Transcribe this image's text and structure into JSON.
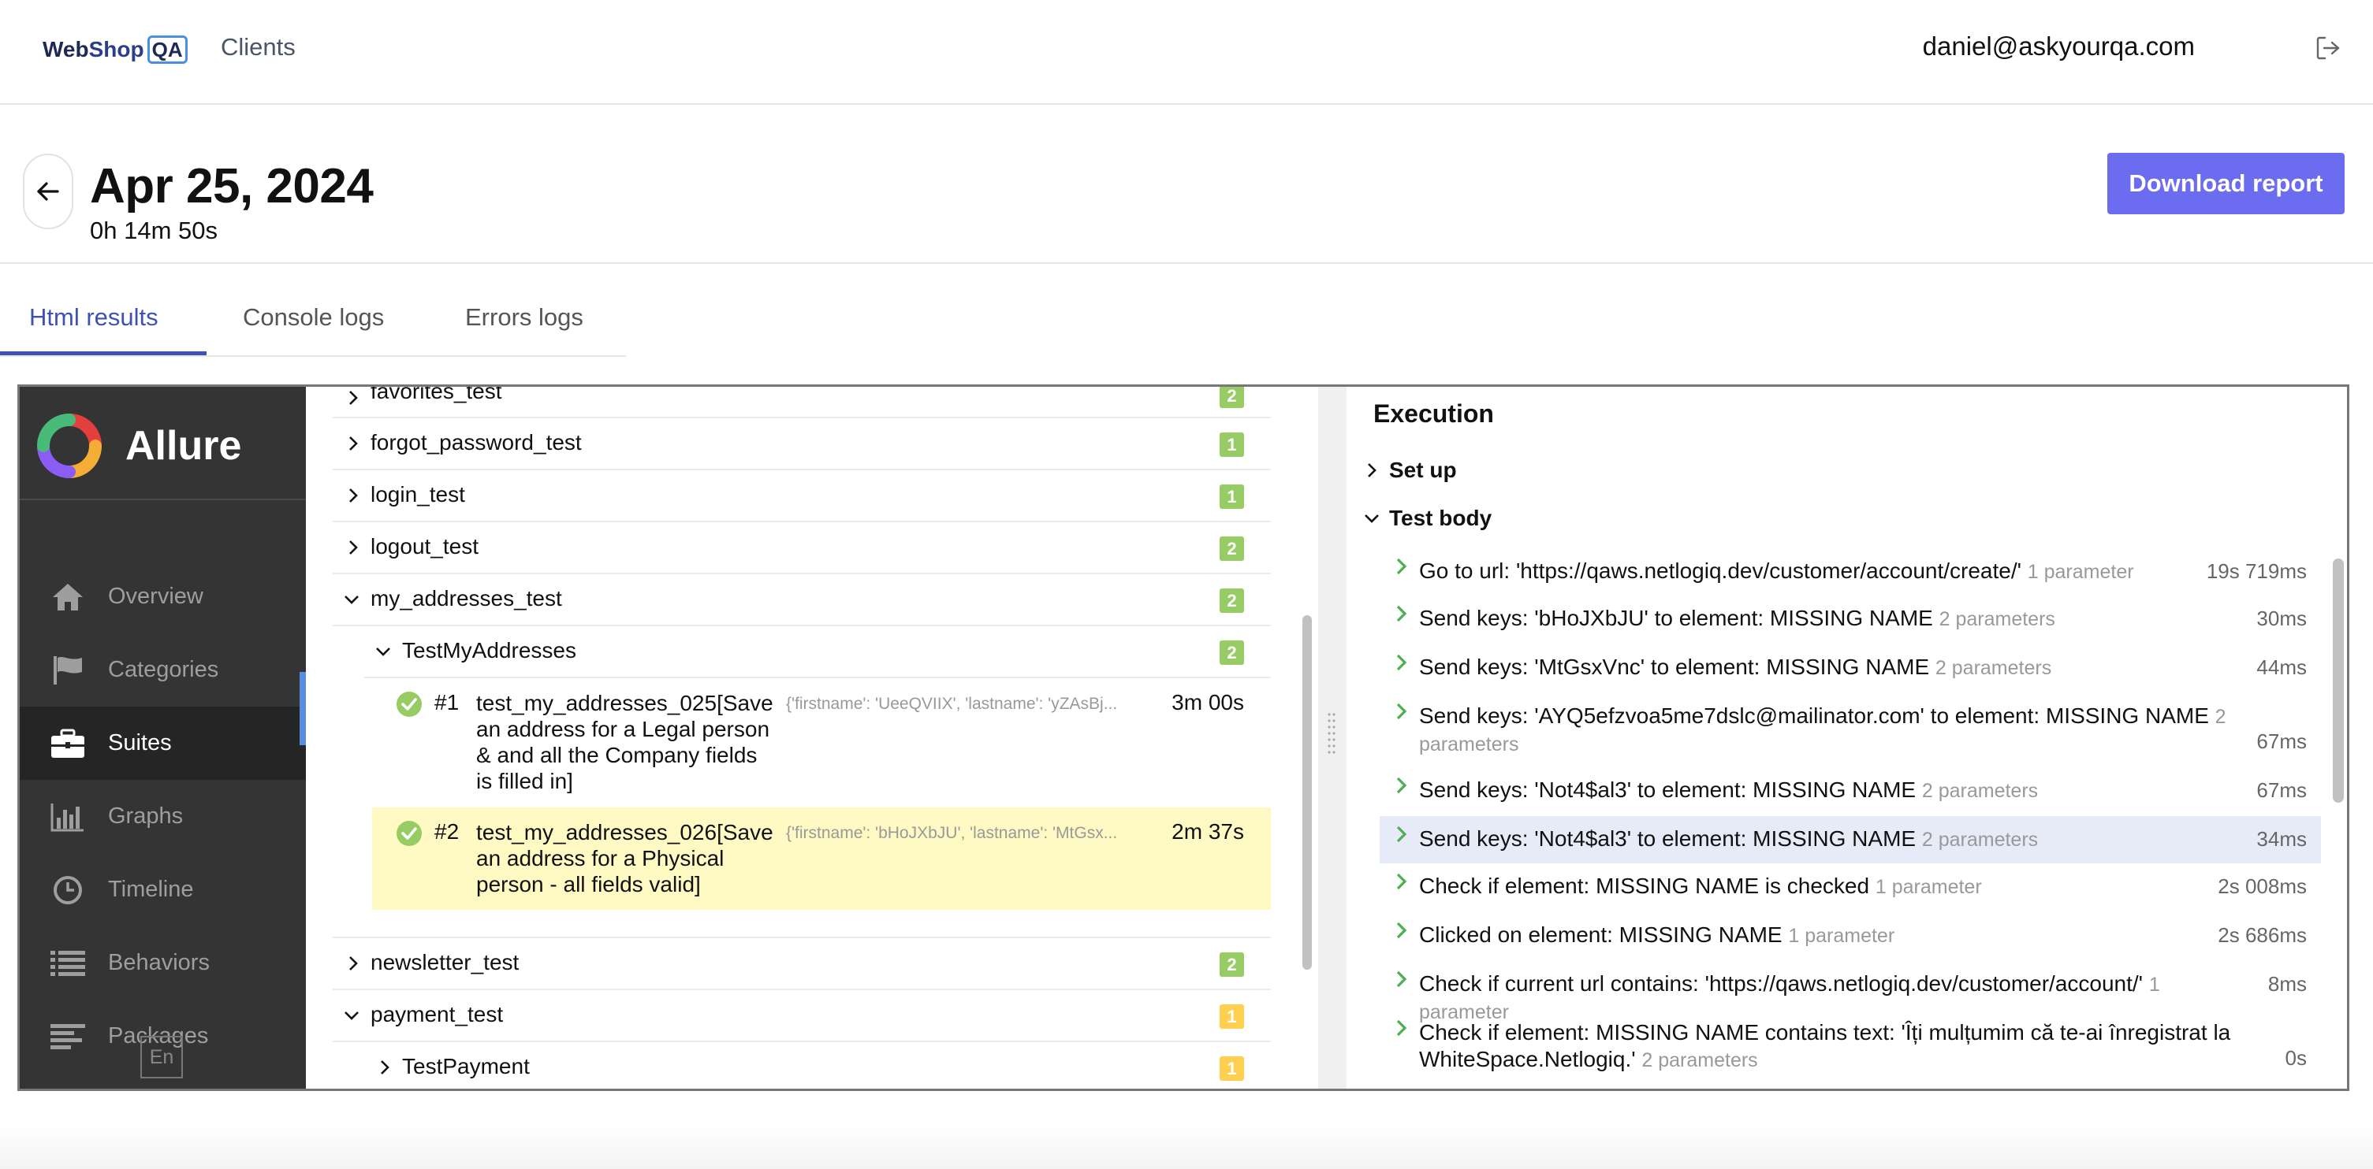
{
  "app": {
    "logo": {
      "part1": "Web",
      "part2": "Shop",
      "part3": "QA"
    },
    "nav_clients": "Clients",
    "user_email": "daniel@askyourqa.com"
  },
  "header": {
    "date": "Apr 25, 2024",
    "duration": "0h 14m 50s",
    "download_label": "Download report"
  },
  "tabs": [
    {
      "label": "Html results",
      "active": true
    },
    {
      "label": "Console logs",
      "active": false
    },
    {
      "label": "Errors logs",
      "active": false
    }
  ],
  "allure": {
    "brand": "Allure",
    "nav": [
      {
        "label": "Overview",
        "icon": "home-icon"
      },
      {
        "label": "Categories",
        "icon": "flag-icon"
      },
      {
        "label": "Suites",
        "icon": "briefcase-icon",
        "active": true
      },
      {
        "label": "Graphs",
        "icon": "bar-chart-icon"
      },
      {
        "label": "Timeline",
        "icon": "clock-icon"
      },
      {
        "label": "Behaviors",
        "icon": "list-icon"
      },
      {
        "label": "Packages",
        "icon": "align-left-icon"
      }
    ],
    "lang": "En"
  },
  "tree": {
    "rows": [
      {
        "name": "favorites_test",
        "count": "2",
        "status": "green",
        "expanded": false
      },
      {
        "name": "forgot_password_test",
        "count": "1",
        "status": "green",
        "expanded": false
      },
      {
        "name": "login_test",
        "count": "1",
        "status": "green",
        "expanded": false
      },
      {
        "name": "logout_test",
        "count": "2",
        "status": "green",
        "expanded": false
      },
      {
        "name": "my_addresses_test",
        "count": "2",
        "status": "green",
        "expanded": true
      },
      {
        "name": "TestMyAddresses",
        "count": "2",
        "status": "green",
        "expanded": true
      },
      {
        "name": "newsletter_test",
        "count": "2",
        "status": "green",
        "expanded": false
      },
      {
        "name": "payment_test",
        "count": "1",
        "status": "yellow",
        "expanded": true
      },
      {
        "name": "TestPayment",
        "count": "1",
        "status": "yellow",
        "expanded": false
      }
    ],
    "cases": [
      {
        "num": "#1",
        "title": "test_my_addresses_025[Save an address for a Legal person & and all the Company fields is filled in]",
        "params": "{'firstname': 'UeeQVIIX', 'lastname': 'yZAsBj...",
        "duration": "3m 00s",
        "selected": false
      },
      {
        "num": "#2",
        "title": "test_my_addresses_026[Save an address for a Physical person - all fields valid]",
        "params": "{'firstname': 'bHoJXbJU', 'lastname': 'MtGsx...",
        "duration": "2m 37s",
        "selected": true
      }
    ]
  },
  "execution": {
    "title": "Execution",
    "setup_label": "Set up",
    "body_label": "Test body",
    "steps": [
      {
        "text": "Go to url: 'https://qaws.netlogiq.dev/customer/account/create/'",
        "params": "1 parameter",
        "duration": "19s 719ms"
      },
      {
        "text": "Send keys: 'bHoJXbJU' to element: MISSING NAME",
        "params": "2 parameters",
        "duration": "30ms"
      },
      {
        "text": "Send keys: 'MtGsxVnc' to element: MISSING NAME",
        "params": "2 parameters",
        "duration": "44ms"
      },
      {
        "text": "Send keys: 'AYQ5efzvoa5me7dslc@mailinator.com' to element: MISSING NAME",
        "params": "2 parameters",
        "duration": "67ms"
      },
      {
        "text": "Send keys: 'Not4$al3' to element: MISSING NAME",
        "params": "2 parameters",
        "duration": "67ms"
      },
      {
        "text": "Send keys: 'Not4$al3' to element: MISSING NAME",
        "params": "2 parameters",
        "duration": "34ms",
        "highlighted": true
      },
      {
        "text": "Check if element: MISSING NAME is checked",
        "params": "1 parameter",
        "duration": "2s 008ms"
      },
      {
        "text": "Clicked on element: MISSING NAME",
        "params": "1 parameter",
        "duration": "2s 686ms"
      },
      {
        "text": "Check if current url contains: 'https://qaws.netlogiq.dev/customer/account/'",
        "params": "1 parameter",
        "duration": "8ms"
      },
      {
        "text": "Check if element: MISSING NAME contains text: 'Îți mulțumim că te-ai înregistrat la WhiteSpace.Netlogiq.'",
        "params": "2 parameters",
        "duration": "0s"
      }
    ]
  },
  "colors": {
    "accent": "#6c6cf0",
    "tab_active": "#3f51b5",
    "sidebar_bg": "#343434",
    "passed": "#97cc64",
    "broken": "#ffd050",
    "selected_row": "#fff9c4",
    "highlight_step": "#e6ebf7"
  }
}
